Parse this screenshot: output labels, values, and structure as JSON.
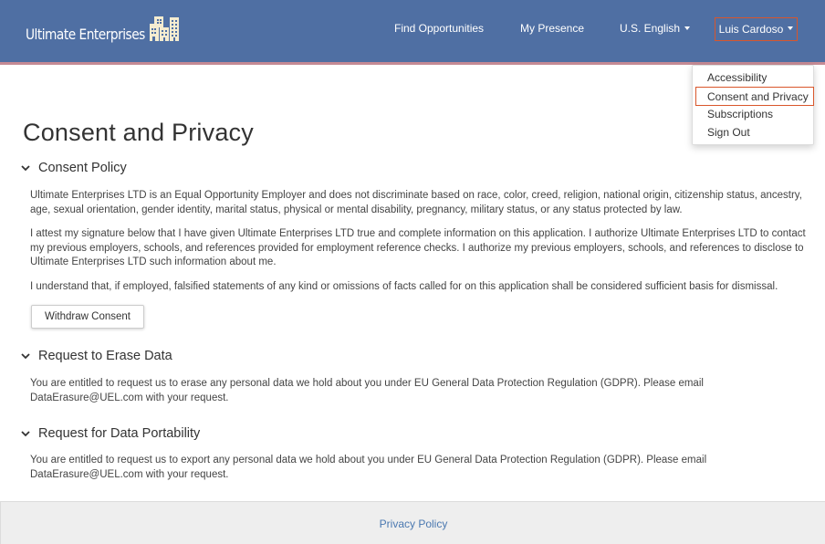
{
  "header": {
    "brand_name": "Ultimate Enterprises",
    "logo_icon": "buildings-icon",
    "nav": {
      "find_opportunities": "Find Opportunities",
      "my_presence": "My Presence",
      "language": "U.S. English",
      "user": "Luis Cardoso"
    }
  },
  "user_menu": {
    "items": [
      {
        "label": "Accessibility"
      },
      {
        "label": "Consent and Privacy",
        "active": true
      },
      {
        "label": "Subscriptions"
      },
      {
        "label": "Sign Out"
      }
    ]
  },
  "main": {
    "title": "Consent and Privacy",
    "sections": [
      {
        "title": "Consent Policy",
        "paragraphs": [
          "Ultimate Enterprises LTD is an Equal Opportunity Employer and does not discriminate based on race, color, creed, religion, national origin, citizenship status, ancestry, age, sexual orientation, gender identity, marital status, physical or mental disability, pregnancy, military status, or any status protected by law.",
          "I attest my signature below that I have given Ultimate Enterprises LTD true and complete information on this application. I authorize Ultimate Enterprises LTD to contact my previous employers, schools, and references provided for employment reference checks. I authorize my previous employers, schools, and references to disclose to Ultimate Enterprises LTD such information about me.",
          "I understand that, if employed, falsified statements of any kind or omissions of facts called for on this application shall be considered sufficient basis for dismissal."
        ],
        "button_label": "Withdraw Consent"
      },
      {
        "title": "Request to Erase Data",
        "paragraphs": [
          "You are entitled to request us to erase any personal data we hold about you under EU General Data Protection Regulation (GDPR). Please email DataErasure@UEL.com with your request."
        ]
      },
      {
        "title": "Request for Data Portability",
        "paragraphs": [
          "You are entitled to request us to export any personal data we hold about you under EU General Data Protection Regulation (GDPR). Please email DataErasure@UEL.com with your request."
        ]
      }
    ]
  },
  "footer": {
    "privacy_policy": "Privacy Policy"
  },
  "colors": {
    "header_bg": "#4f6fa3",
    "header_stripe": "#c58a94",
    "highlight_border": "#d9562b",
    "link": "#4a78b0",
    "footer_bg": "#eeeeee"
  }
}
